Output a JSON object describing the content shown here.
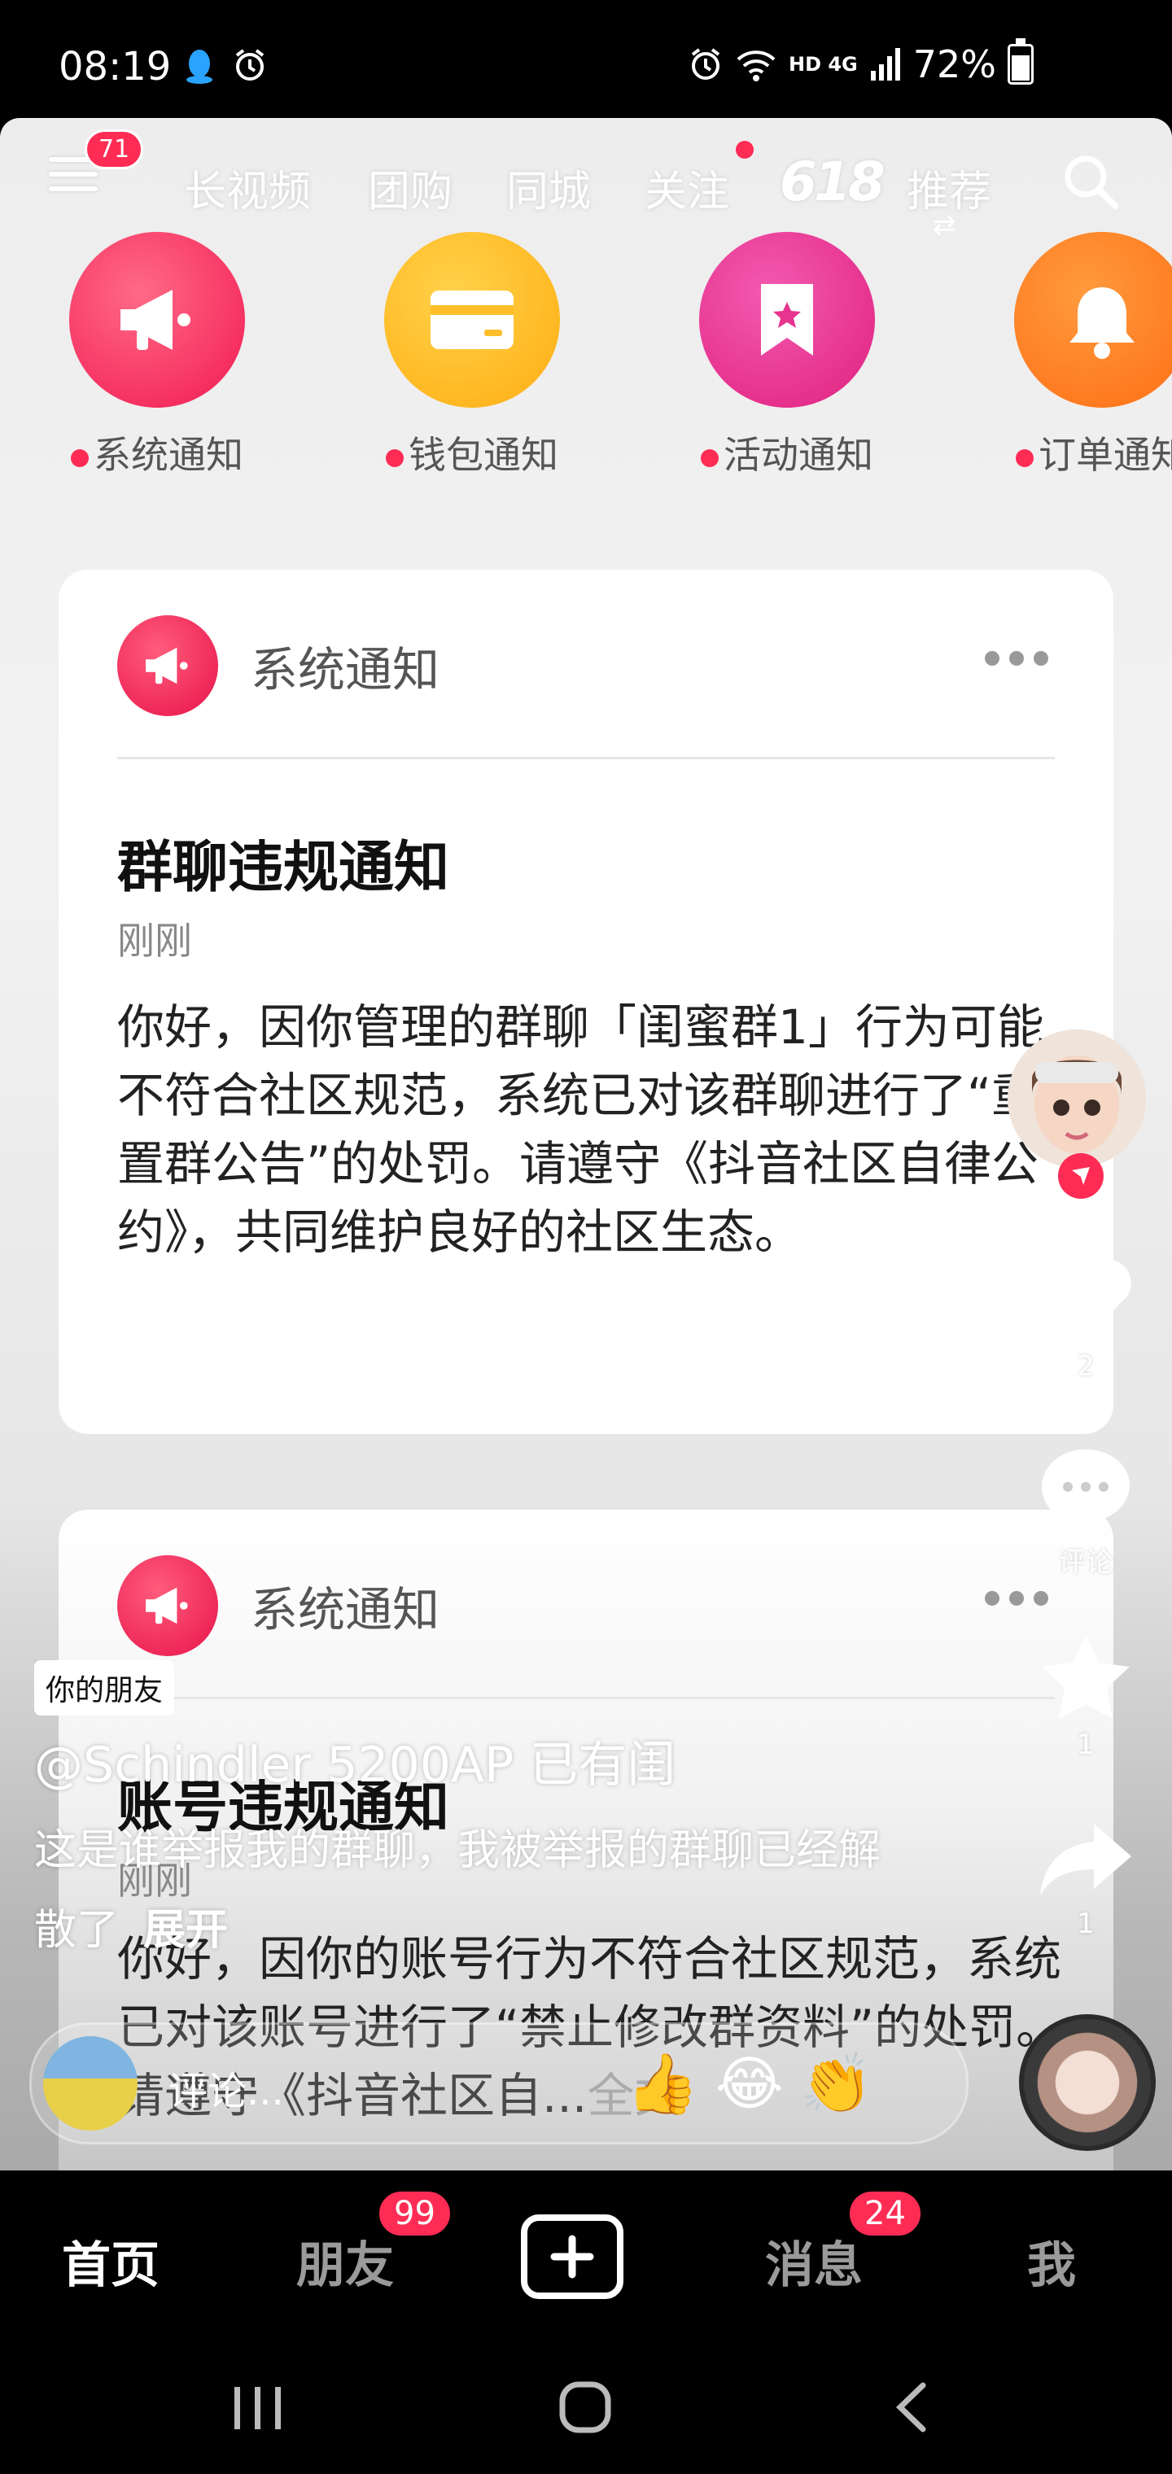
{
  "status_bar": {
    "time": "08:19",
    "battery": "72%",
    "network": "HD 4G",
    "left_icons": [
      "qq-icon",
      "alarm-icon"
    ],
    "right_icons": [
      "alarm-icon",
      "wifi-icon",
      "signal-icon",
      "battery-icon"
    ]
  },
  "top_nav": {
    "menu_badge": "71",
    "tabs": [
      "长视频",
      "团购",
      "同城",
      "关注",
      "推荐"
    ],
    "promo": "618"
  },
  "categories": [
    {
      "label": "系统通知",
      "color": "#fe2c55",
      "icon": "megaphone-icon"
    },
    {
      "label": "钱包通知",
      "color": "#ffb21b",
      "icon": "wallet-icon"
    },
    {
      "label": "活动通知",
      "color": "#e6348f",
      "icon": "bookmark-star-icon"
    },
    {
      "label": "订单通知",
      "color": "#ff7a1a",
      "icon": "bell-icon"
    }
  ],
  "cards": [
    {
      "source": "系统通知",
      "title": "群聊违规通知",
      "time": "刚刚",
      "body": "你好，因你管理的群聊「闺蜜群1」行为可能不符合社区规范，系统已对该群聊进行了“重置群公告”的处罚。请遵守《抖音社区自律公约》，共同维护良好的社区生态。"
    },
    {
      "source": "系统通知",
      "title": "账号违规通知",
      "time": "刚刚",
      "body": "你好，因你的账号行为不符合社区规范，系统已对该账号进行了“禁止修改群资料”的处罚。请遵守《抖音社区自...",
      "more": "全文"
    }
  ],
  "rail": {
    "likes": "2",
    "comments": "评论",
    "favorites": "1",
    "shares": "1"
  },
  "post": {
    "friend_tag": "你的朋友",
    "author": "@Schindler 5200AP 已有闺",
    "caption": "这是谁举报我的群聊，我被举报的群聊已经解散了",
    "expand": "展开",
    "comment_placeholder": "评论...",
    "emojis": [
      "👍",
      "😂",
      "👏"
    ]
  },
  "tabbar": {
    "home": "首页",
    "friends": "朋友",
    "friends_badge": "99",
    "messages": "消息",
    "messages_badge": "24",
    "me": "我"
  },
  "colors": {
    "accent": "#fe2c55",
    "background": "#000000"
  }
}
